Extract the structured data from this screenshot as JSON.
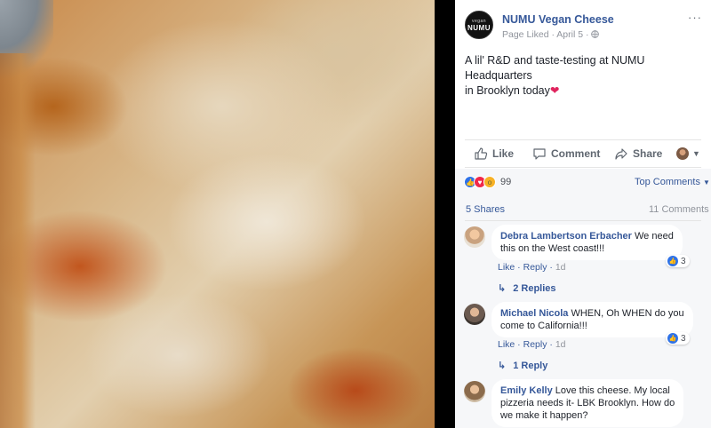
{
  "post": {
    "page_name": "NUMU Vegan Cheese",
    "avatar_text": "NUMU",
    "avatar_small_text": "vegan",
    "meta": "Page Liked · April 5 · ",
    "more": "···",
    "text_line1": "A lil' R&D and taste-testing at NUMU Headquarters",
    "text_line2": "in Brooklyn today",
    "heart": "❤"
  },
  "actions": {
    "like": "Like",
    "comment": "Comment",
    "share": "Share"
  },
  "stats": {
    "reaction_count": "99",
    "top_comments": "Top Comments",
    "shares": "5 Shares",
    "comments": "11 Comments"
  },
  "comments": [
    {
      "name": "Debra Lambertson Erbacher",
      "text": " We need",
      "text2": "this on the West coast!!!",
      "like": "Like",
      "reply": "Reply",
      "time": "1d",
      "reactions": "3",
      "replies": "2 Replies"
    },
    {
      "name": "Michael Nicola",
      "text": " WHEN, Oh WHEN do you",
      "text2": "come to California!!!",
      "like": "Like",
      "reply": "Reply",
      "time": "1d",
      "reactions": "3",
      "replies": "1 Reply"
    },
    {
      "name": "Emily Kelly",
      "text": " Love this cheese. My local",
      "text2": "pizzeria needs it- LBK Brooklyn. How do",
      "text3": "we make it happen?"
    }
  ],
  "colors": {
    "link": "#365899",
    "like_blue": "#2e72e8",
    "love_red": "#f0284a",
    "meta_gray": "#90949c"
  }
}
